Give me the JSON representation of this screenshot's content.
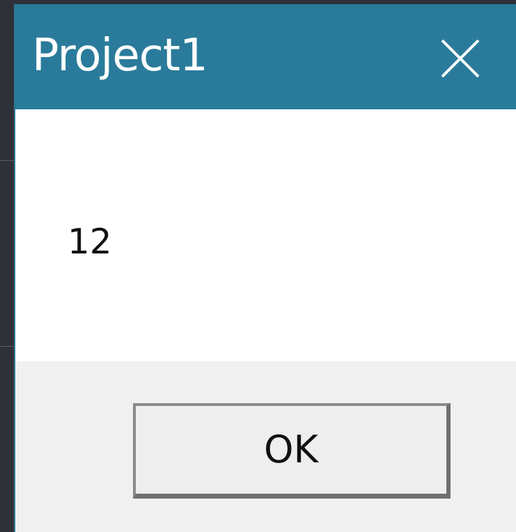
{
  "dialog": {
    "title": "Project1",
    "message": "12",
    "ok_label": "OK"
  },
  "colors": {
    "titlebar": "#2a7b9b",
    "title_text": "#ffffff",
    "content_bg": "#ffffff",
    "footer_bg": "#f0f0f0",
    "backdrop": "#2f3139"
  },
  "icons": {
    "close": "close-icon"
  }
}
